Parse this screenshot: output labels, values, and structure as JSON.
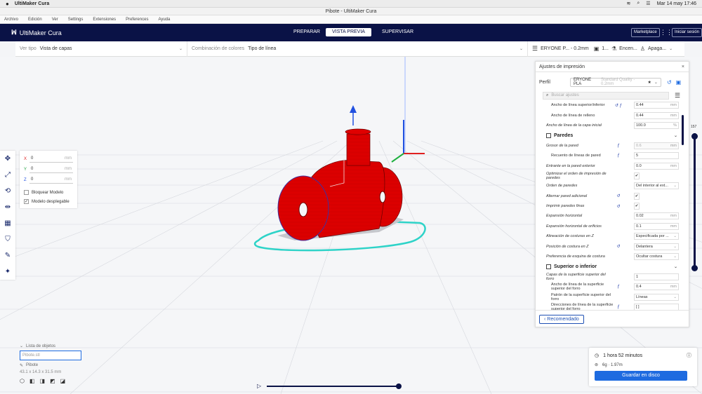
{
  "macbar": {
    "apple": "",
    "app": "UltiMaker Cura",
    "datetime": "Mar 14 may 17:46"
  },
  "window_title": "Pibote - UltiMaker Cura",
  "menu": [
    "Archivo",
    "Edición",
    "Ver",
    "Settings",
    "Extensiones",
    "Preferences",
    "Ayuda"
  ],
  "header": {
    "logo": "UltiMaker Cura",
    "stages": [
      "PREPARAR",
      "VISTA PREVIA",
      "SUPERVISAR"
    ],
    "active_stage": "VISTA PREVIA",
    "marketplace": "Marketplace",
    "signin": "Iniciar sesión"
  },
  "subbar": {
    "view_label": "Ver tipo",
    "view_value": "Vista de capas",
    "color_label": "Combinación de colores",
    "color_value": "Tipo de línea",
    "printer": "ERYONE P... - 0.2mm",
    "material": "1...",
    "adhesion": "Encen...",
    "support": "Apaga..."
  },
  "move_panel": {
    "axes": [
      {
        "axis": "X",
        "value": "0",
        "unit": "mm"
      },
      {
        "axis": "Y",
        "value": "0",
        "unit": "mm"
      },
      {
        "axis": "Z",
        "value": "0",
        "unit": "mm"
      }
    ],
    "lock_model": "Bloquear Modelo",
    "drop_model": "Modelo desplegable"
  },
  "settings": {
    "title": "Ajustes de impresión",
    "profile_label": "Perfil",
    "profile_value": "ERYONE PLA",
    "profile_sub": "Standard Quality - 0.2mm",
    "search_placeholder": "Buscar ajustes",
    "rows": [
      {
        "type": "s",
        "ind": true,
        "name": "Ancho de línea superior/inferior",
        "icons": "↺ ƒ",
        "value": "0.44",
        "unit": "mm"
      },
      {
        "type": "s",
        "ind": true,
        "name": "Ancho de línea de relleno",
        "icons": "",
        "value": "0.44",
        "unit": "mm"
      },
      {
        "type": "s",
        "ind": false,
        "name": "Ancho de línea de la capa inicial",
        "icons": "",
        "value": "100.0",
        "unit": "%"
      },
      {
        "type": "c",
        "name": "Paredes"
      },
      {
        "type": "s",
        "ind": false,
        "name": "Grosor de la pared",
        "icons": "ƒ",
        "value": "0.6",
        "unit": "mm",
        "dis": true
      },
      {
        "type": "s",
        "ind": true,
        "name": "Recuento de líneas de pared",
        "icons": "ƒ",
        "value": "5",
        "unit": ""
      },
      {
        "type": "s",
        "ind": false,
        "name": "Entrante en la pared exterior",
        "icons": "",
        "value": "0.0",
        "unit": "mm"
      },
      {
        "type": "s",
        "ind": false,
        "name": "Optimizar el orden de impresión de paredes",
        "icons": "",
        "value": "✔",
        "unit": "",
        "chk": true
      },
      {
        "type": "s",
        "ind": false,
        "name": "Orden de paredes",
        "icons": "",
        "value": "Del interior al ext...",
        "unit": "⌄"
      },
      {
        "type": "s",
        "ind": false,
        "name": "Alternar pared adicional",
        "icons": "↺",
        "value": "✔",
        "unit": "",
        "chk": true
      },
      {
        "type": "s",
        "ind": false,
        "name": "Imprimir paredes finas",
        "icons": "↺",
        "value": "✔",
        "unit": "",
        "chk": true
      },
      {
        "type": "s",
        "ind": false,
        "name": "Expansión horizontal",
        "icons": "",
        "value": "0.02",
        "unit": "mm"
      },
      {
        "type": "s",
        "ind": false,
        "name": "Expansión horizontal de orificios",
        "icons": "",
        "value": "0.1",
        "unit": "mm"
      },
      {
        "type": "s",
        "ind": false,
        "name": "Alineación de costuras en Z",
        "icons": "",
        "value": "Especificada por ...",
        "unit": "⌄"
      },
      {
        "type": "s",
        "ind": false,
        "name": "Posición de costura en Z",
        "icons": "↺",
        "value": "Delantera",
        "unit": "⌄"
      },
      {
        "type": "s",
        "ind": false,
        "name": "Preferencia de esquina de costura",
        "icons": "",
        "value": "Ocultar costura",
        "unit": "⌄"
      },
      {
        "type": "c",
        "name": "Superior o inferior"
      },
      {
        "type": "s",
        "ind": false,
        "name": "Capas de la superficie superior del forro",
        "icons": "",
        "value": "1",
        "unit": ""
      },
      {
        "type": "s",
        "ind": true,
        "name": "Ancho de línea de la superficie superior del forro",
        "icons": "ƒ",
        "value": "0.4",
        "unit": "mm"
      },
      {
        "type": "s",
        "ind": true,
        "name": "Patrón de la superficie superior del forro",
        "icons": "",
        "value": "Líneas",
        "unit": "⌄"
      },
      {
        "type": "s",
        "ind": true,
        "name": "Direcciones de línea de la superficie superior del forro",
        "icons": "ƒ",
        "value": "[ ]",
        "unit": ""
      }
    ],
    "recommended": "Recomendado"
  },
  "layer": {
    "current": "157",
    "level": 1.0
  },
  "print_info": {
    "time": "1 hora 52 minutos",
    "material": "6g · 1.97m",
    "save": "Guardar en disco"
  },
  "objects": {
    "title": "Lista de objetos",
    "filename": "Pibote.stl",
    "model": "Pibote",
    "dims": "43.1 x 14.3 x 31.5 mm"
  },
  "preview_progress": 1.0,
  "colors": {
    "header": "#0a1246",
    "accent": "#1e6be0",
    "model": "#e00000",
    "skirt": "#2ed3c8",
    "grid": "#dcdde2"
  }
}
